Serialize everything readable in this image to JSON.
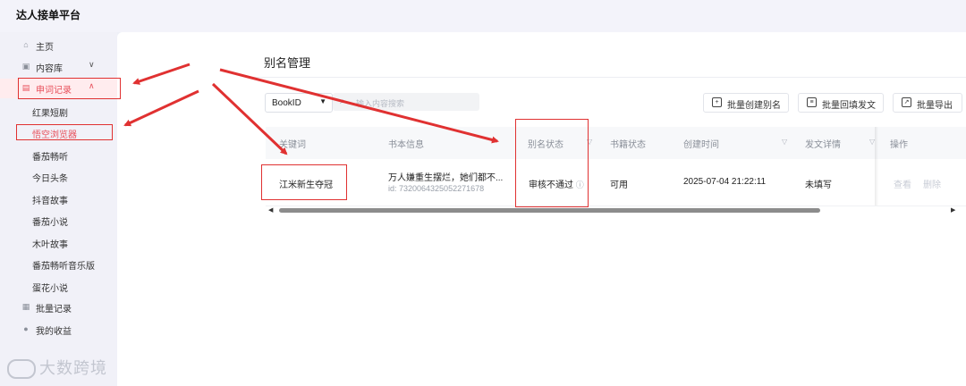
{
  "app": {
    "title": "达人接单平台"
  },
  "sidebar": {
    "items": [
      {
        "label": "主页",
        "icon": "home-icon"
      },
      {
        "label": "内容库",
        "icon": "library-icon",
        "chevron": "∨"
      },
      {
        "label": "申词记录",
        "icon": "document-icon",
        "chevron": "∧",
        "active": true
      },
      {
        "label": "批量记录",
        "icon": "grid-icon"
      },
      {
        "label": "我的收益",
        "icon": "coin-icon"
      }
    ],
    "sub_items": [
      "红果短剧",
      "悟空浏览器",
      "番茄畅听",
      "今日头条",
      "抖音故事",
      "番茄小说",
      "木叶故事",
      "番茄畅听音乐版",
      "蛋花小说"
    ],
    "selected_sub": "悟空浏览器"
  },
  "watermark": {
    "text": "大数跨境"
  },
  "page": {
    "title": "别名管理"
  },
  "toolbar": {
    "select_value": "BookID",
    "search_placeholder": "输入内容搜索",
    "buttons": [
      "批量创建别名",
      "批量回填发文",
      "批量导出"
    ]
  },
  "table": {
    "headers": [
      "关键词",
      "书本信息",
      "别名状态",
      "书籍状态",
      "创建时间",
      "发文详情",
      "操作"
    ],
    "rows": [
      {
        "keyword": "江米新生夺冠",
        "book_title": "万人嫌重生摆烂，她们都不...",
        "book_id": "id: 7320064325052271678",
        "alias_status": "审核不通过",
        "book_status": "可用",
        "created": "2025-07-04 21:22:11",
        "post_detail": "未填写",
        "actions": [
          "查看",
          "删除"
        ]
      }
    ]
  },
  "colors": {
    "accent": "#e8505b",
    "annotation": "#e03131"
  }
}
